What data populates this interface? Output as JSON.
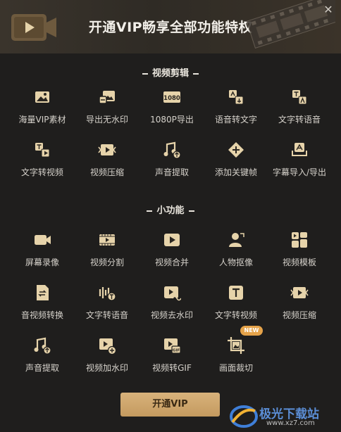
{
  "header": {
    "title": "开通VIP畅享全部功能特权",
    "close_glyph": "✕"
  },
  "sections": [
    {
      "title": "视频剪辑"
    },
    {
      "title": "小功能"
    }
  ],
  "video_editing": [
    {
      "label": "海量VIP素材",
      "icon": "image-icon"
    },
    {
      "label": "导出无水印",
      "icon": "no-watermark-icon"
    },
    {
      "label": "1080P导出",
      "icon": "1080p-icon",
      "icon_text": "1080"
    },
    {
      "label": "语音转文字",
      "icon": "speech-to-text-icon"
    },
    {
      "label": "文字转语音",
      "icon": "text-to-speech-icon"
    },
    {
      "label": "文字转视频",
      "icon": "text-to-video-icon"
    },
    {
      "label": "视频压缩",
      "icon": "video-compress-icon"
    },
    {
      "label": "声音提取",
      "icon": "audio-extract-icon"
    },
    {
      "label": "添加关键帧",
      "icon": "keyframe-icon"
    },
    {
      "label": "字幕导入/导出",
      "icon": "subtitle-icon"
    }
  ],
  "small_tools": [
    {
      "label": "屏幕录像",
      "icon": "screen-record-icon"
    },
    {
      "label": "视频分割",
      "icon": "video-split-icon"
    },
    {
      "label": "视频合并",
      "icon": "video-merge-icon"
    },
    {
      "label": "人物抠像",
      "icon": "person-cutout-icon"
    },
    {
      "label": "视频模板",
      "icon": "video-template-icon"
    },
    {
      "label": "音视频转换",
      "icon": "av-convert-icon"
    },
    {
      "label": "文字转语音",
      "icon": "text-to-speech-icon"
    },
    {
      "label": "视频去水印",
      "icon": "remove-watermark-icon"
    },
    {
      "label": "文字转视频",
      "icon": "text-to-video-icon"
    },
    {
      "label": "视频压缩",
      "icon": "video-compress-icon"
    },
    {
      "label": "声音提取",
      "icon": "audio-extract-icon"
    },
    {
      "label": "视频加水印",
      "icon": "add-watermark-icon"
    },
    {
      "label": "视频转GIF",
      "icon": "video-to-gif-icon",
      "icon_text": "GIF"
    },
    {
      "label": "画面裁切",
      "icon": "crop-icon",
      "badge": "NEW"
    }
  ],
  "cta": {
    "label": "开通VIP"
  },
  "watermark": {
    "text": "极光下载站",
    "url": "www.xz7.com"
  },
  "colors": {
    "background": "#1f1e1d",
    "accent_gold": "#c9a066",
    "badge": "#e5a34a"
  }
}
